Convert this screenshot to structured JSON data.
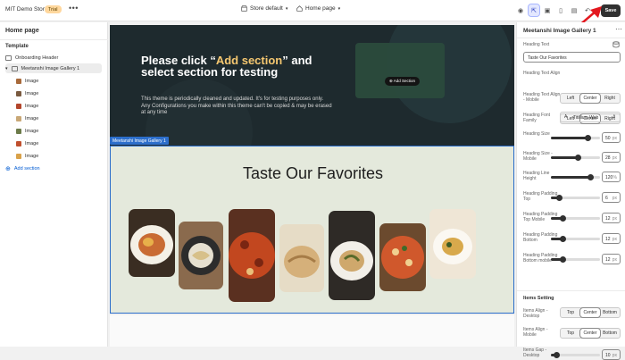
{
  "topbar": {
    "store_name": "MIT Demo Store",
    "trial_badge": "Trial",
    "more_label": "•••",
    "theme_label": "Store default",
    "page_label": "Home page",
    "save_label": "Save"
  },
  "sidebar": {
    "title": "Home page",
    "section_label": "Template",
    "items": [
      {
        "label": "Onboarding Header"
      },
      {
        "label": "Meetanshi Image Gallery 1"
      },
      {
        "label": "Image"
      },
      {
        "label": "Image"
      },
      {
        "label": "Image"
      },
      {
        "label": "Image"
      },
      {
        "label": "Image"
      },
      {
        "label": "Image"
      },
      {
        "label": "Image"
      }
    ],
    "add_section_label": "Add section"
  },
  "canvas": {
    "hero": {
      "title_pre": "Please click “",
      "title_highlight": "Add section",
      "title_post": "” and select section for testing",
      "body": "This theme is periodically cleaned and updated. It's for testing purposes only. Any Configurations you make within this theme can't be copied & may be erased at any time",
      "add_pill": "Add Section"
    },
    "block_label": "Meetanshi Image Gallery 1",
    "gallery_heading": "Taste Our Favorites"
  },
  "panel": {
    "title": "Meetanshi Image Gallery 1",
    "heading_text_label": "Heading Text",
    "heading_text_value": "Taste Our Favorites",
    "align_label": "Heading Text Align",
    "align_mobile_label": "Heading Text Align - Mobile",
    "align_options": [
      "Left",
      "Center",
      "Right"
    ],
    "font_label": "Heading Font Family",
    "font_value": "Titillium Web",
    "sliders": [
      {
        "label": "Heading Size",
        "value": "50",
        "unit": "px",
        "level": 0.75
      },
      {
        "label": "Heading Size - Mobile",
        "value": "28",
        "unit": "px",
        "level": 0.55
      },
      {
        "label": "Heading Line Height",
        "value": "120",
        "unit": "%",
        "level": 0.8
      },
      {
        "label": "Heading Padding Top",
        "value": "6",
        "unit": "px",
        "level": 0.18
      },
      {
        "label": "Heading Padding Top Mobile",
        "value": "12",
        "unit": "px",
        "level": 0.25
      },
      {
        "label": "Heading Padding Bottom",
        "value": "12",
        "unit": "px",
        "level": 0.25
      },
      {
        "label": "Heading Padding Bottom mobile",
        "value": "12",
        "unit": "px",
        "level": 0.25
      }
    ],
    "items_section": "Items Setting",
    "items_align_desktop_label": "Items Align - Desktop",
    "items_align_mobile_label": "Items Align - Mobile",
    "items_align_options": [
      "Top",
      "Center",
      "Bottom"
    ],
    "items_gap_label": "Items Gap - Desktop",
    "items_gap_value": "10",
    "items_gap_unit": "px"
  }
}
